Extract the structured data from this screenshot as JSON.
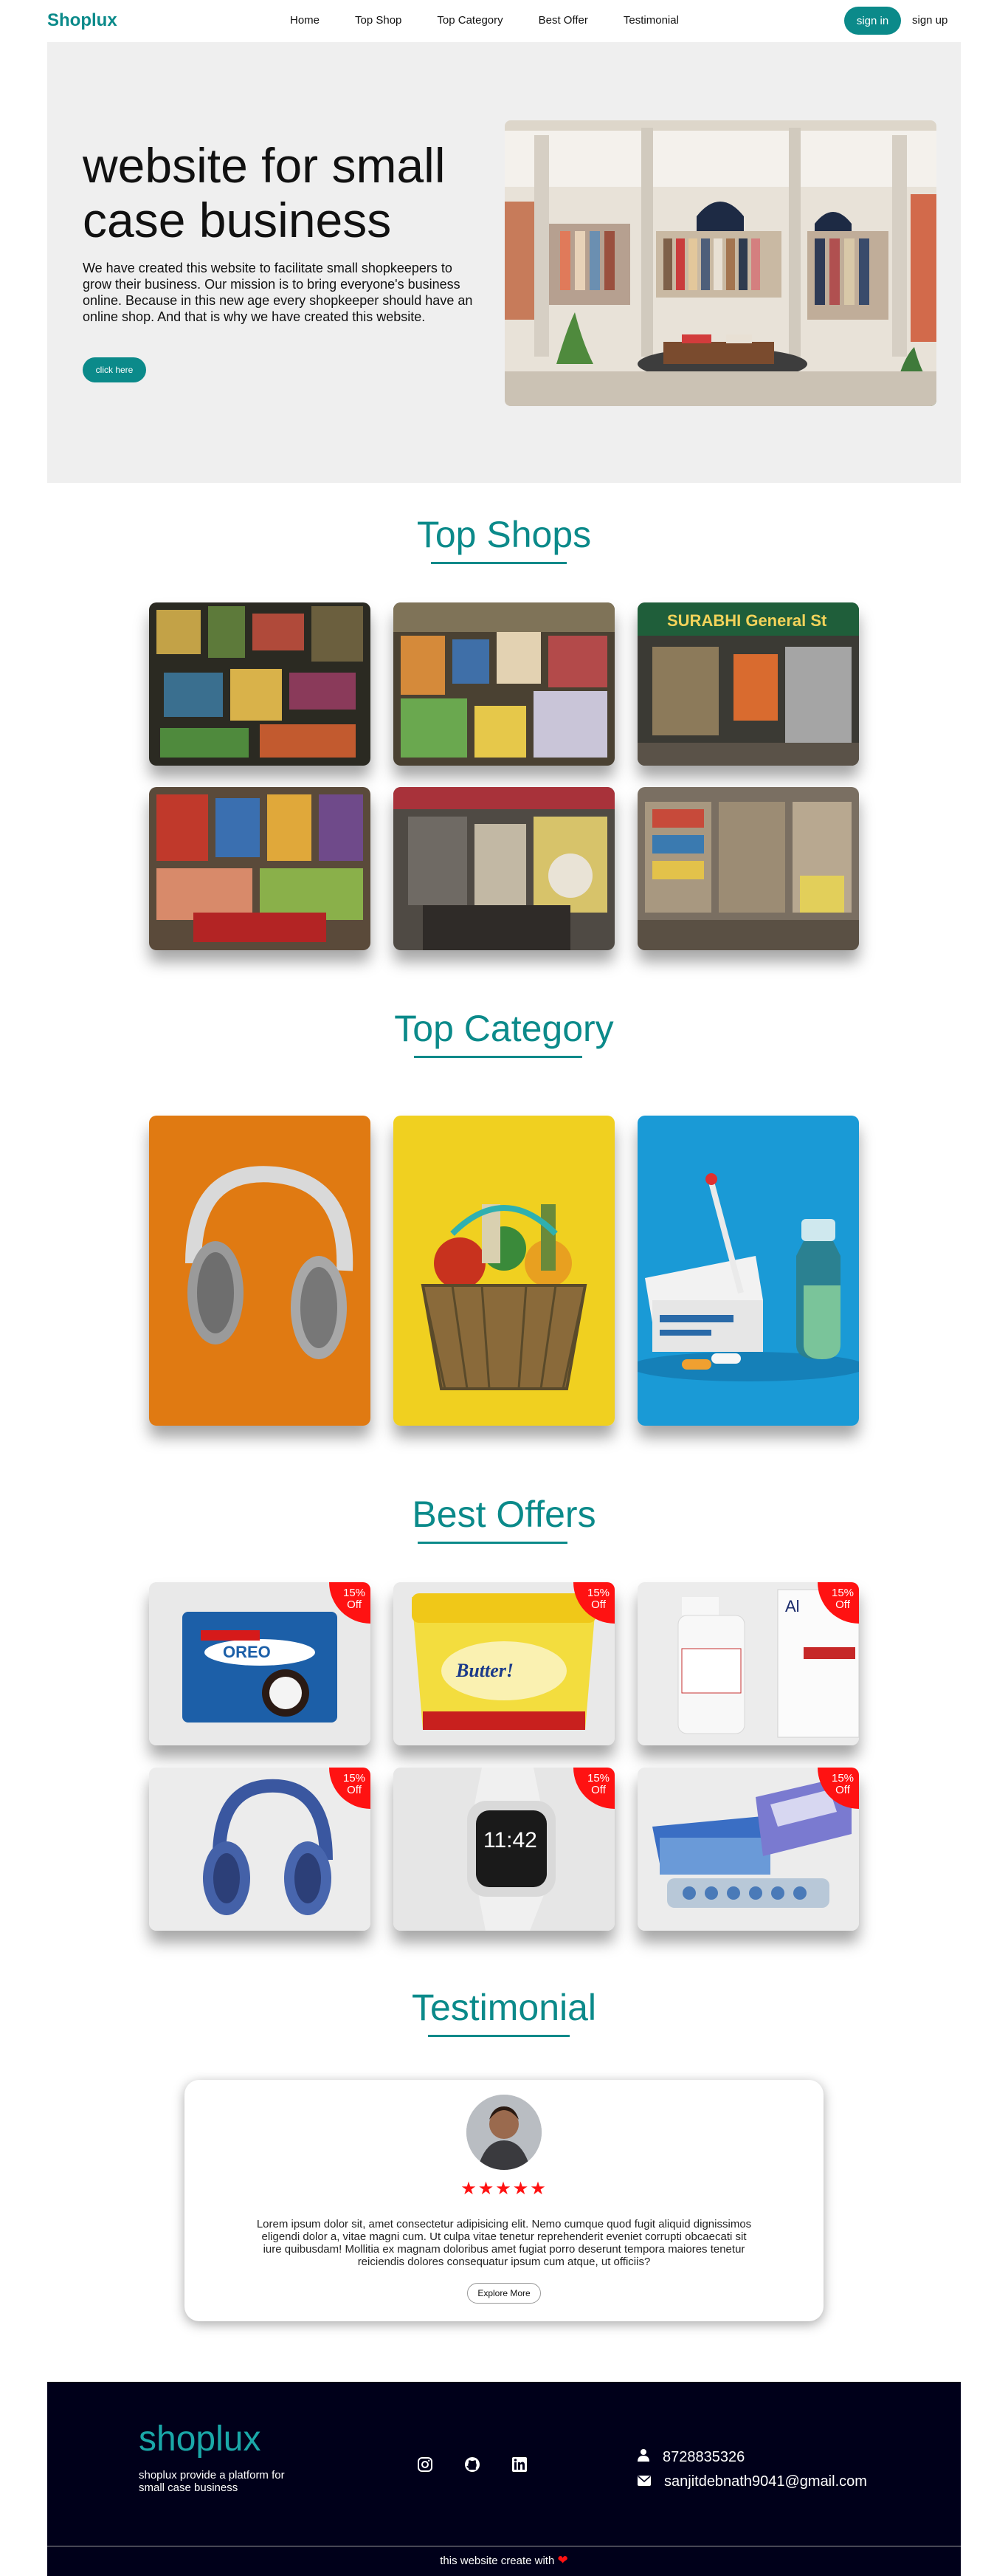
{
  "nav": {
    "brand": "Shoplux",
    "links": [
      "Home",
      "Top Shop",
      "Top Category",
      "Best Offer",
      "Testimonial"
    ],
    "signin": "sign in",
    "signup": "sign up"
  },
  "hero": {
    "title": "website for small case business",
    "text": "We have created this website to facilitate small shopkeepers to grow their business. Our mission is to bring everyone's business online. Because in this new age every shopkeeper should have an online shop. And that is why we have created this website.",
    "button": "click here"
  },
  "sections": {
    "top_shops": "Top Shops",
    "top_category": "Top Category",
    "best_offers": "Best Offers",
    "testimonial": "Testimonial"
  },
  "offers": {
    "badge_pct": "15%",
    "badge_off": "Off"
  },
  "testimonial": {
    "stars": "★★★★★",
    "text": "Lorem ipsum dolor sit, amet consectetur adipisicing elit. Nemo cumque quod fugit aliquid dignissimos eligendi dolor a, vitae magni cum. Ut culpa vitae tenetur reprehenderit eveniet corrupti obcaecati sit iure quibusdam! Mollitia ex magnam doloribus amet fugiat porro deserunt tempora maiores tenetur reiciendis dolores consequatur ipsum cum atque, ut officiis?",
    "button": "Explore More"
  },
  "footer": {
    "brand": "shoplux",
    "desc": "shoplux provide a platform for small case business",
    "phone": "8728835326",
    "email": "sanjitdebnath9041@gmail.com",
    "bottom": "this website create with"
  },
  "colors": {
    "accent": "#0b8a8a",
    "badge": "#ff1212",
    "footer_bg": "#00001a"
  },
  "icons": {
    "social": [
      "instagram-icon",
      "github-icon",
      "linkedin-icon"
    ],
    "contact": [
      "user-icon",
      "mail-icon"
    ],
    "heart": "heart-icon"
  }
}
